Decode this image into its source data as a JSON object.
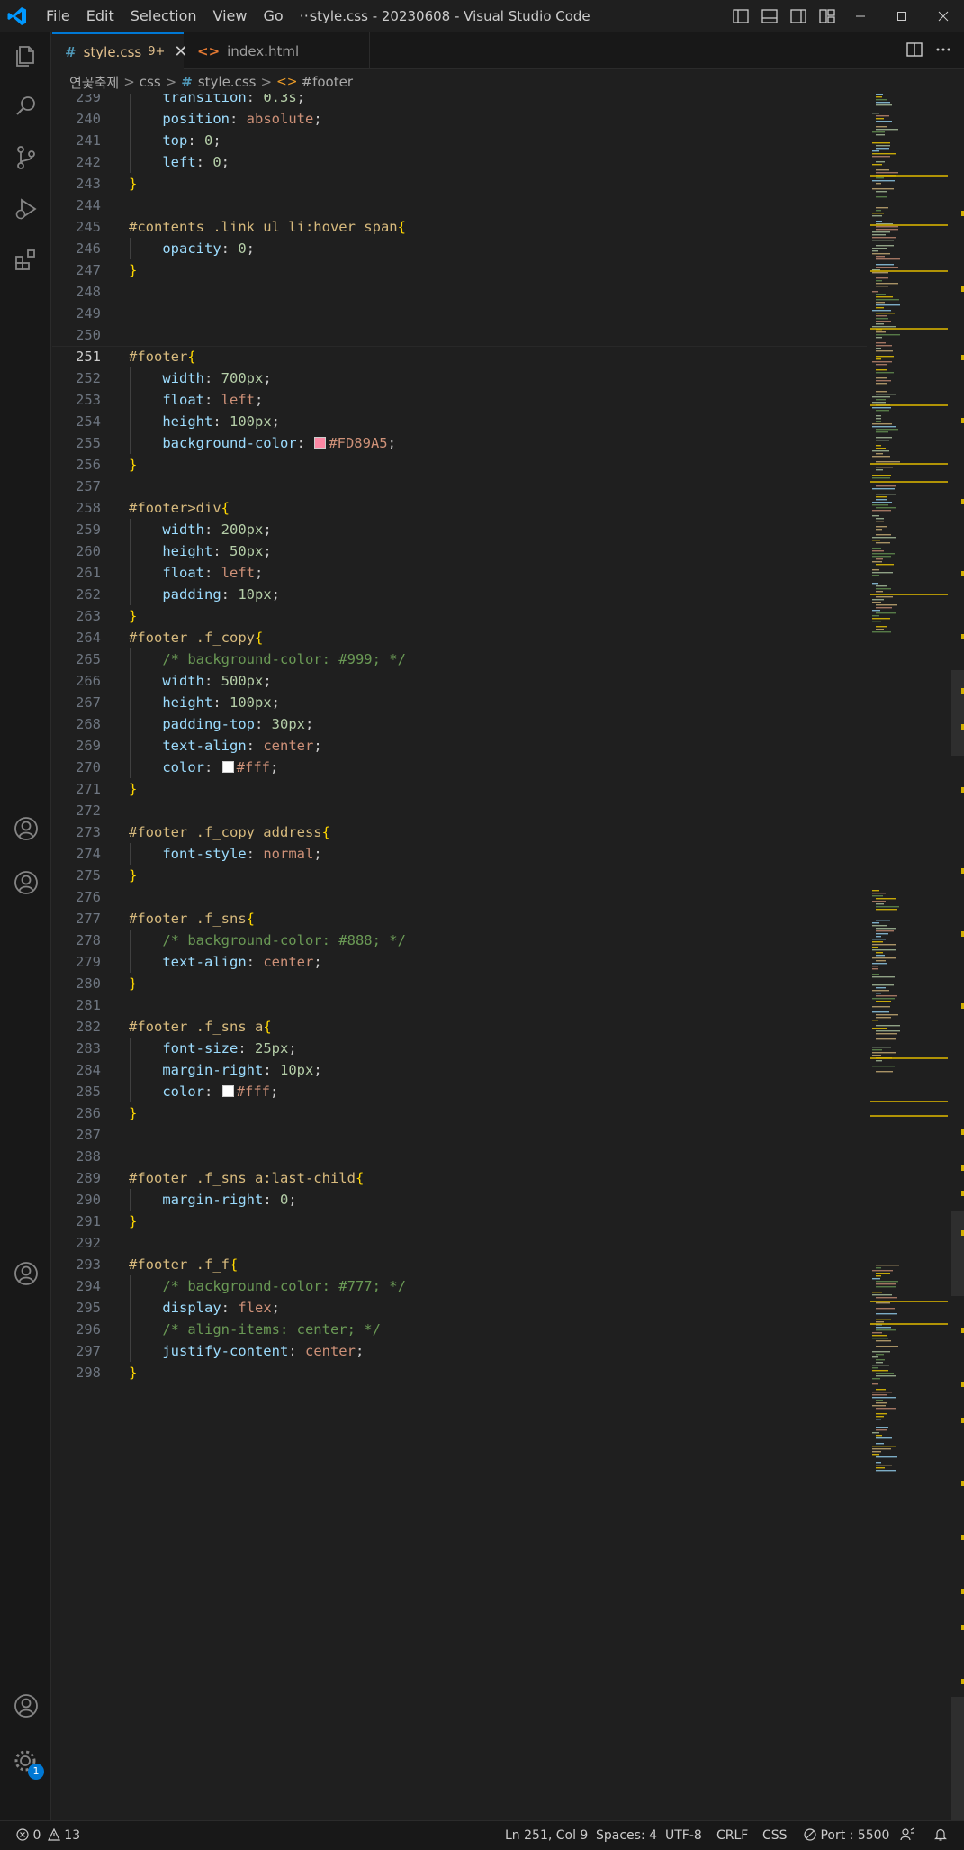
{
  "window": {
    "title": "style.css - 20230608 - Visual Studio Code"
  },
  "menu": [
    "File",
    "Edit",
    "Selection",
    "View",
    "Go",
    "···"
  ],
  "tabs": [
    {
      "label": "style.css",
      "icon": "#",
      "badge": "9+",
      "close": "✕"
    },
    {
      "label": "index.html",
      "icon": "<>"
    }
  ],
  "breadcrumb": {
    "folder": "연꽃축제",
    "subfolder": "css",
    "file": "style.css",
    "file_icon": "#",
    "symbol": "#footer",
    "separator": ">"
  },
  "editor": {
    "cursor_line": "251",
    "lines": [
      {
        "n": "239",
        "t": [
          [
            "pun",
            "    "
          ],
          [
            "prop",
            "transition"
          ],
          [
            "pun",
            ": "
          ],
          [
            "num",
            "0.3s"
          ],
          [
            "pun",
            ";"
          ]
        ]
      },
      {
        "n": "240",
        "t": [
          [
            "pun",
            "    "
          ],
          [
            "prop",
            "position"
          ],
          [
            "pun",
            ": "
          ],
          [
            "kw",
            "absolute"
          ],
          [
            "pun",
            ";"
          ]
        ]
      },
      {
        "n": "241",
        "t": [
          [
            "pun",
            "    "
          ],
          [
            "prop",
            "top"
          ],
          [
            "pun",
            ": "
          ],
          [
            "num",
            "0"
          ],
          [
            "pun",
            ";"
          ]
        ]
      },
      {
        "n": "242",
        "t": [
          [
            "pun",
            "    "
          ],
          [
            "prop",
            "left"
          ],
          [
            "pun",
            ": "
          ],
          [
            "num",
            "0"
          ],
          [
            "pun",
            ";"
          ]
        ]
      },
      {
        "n": "243",
        "t": [
          [
            "br",
            "}"
          ]
        ]
      },
      {
        "n": "244",
        "t": []
      },
      {
        "n": "245",
        "t": [
          [
            "sel",
            "#contents .link ul li:hover span"
          ],
          [
            "br",
            "{"
          ]
        ]
      },
      {
        "n": "246",
        "t": [
          [
            "pun",
            "    "
          ],
          [
            "prop",
            "opacity"
          ],
          [
            "pun",
            ": "
          ],
          [
            "num",
            "0"
          ],
          [
            "pun",
            ";"
          ]
        ]
      },
      {
        "n": "247",
        "t": [
          [
            "br",
            "}"
          ]
        ]
      },
      {
        "n": "248",
        "t": []
      },
      {
        "n": "249",
        "t": []
      },
      {
        "n": "250",
        "t": []
      },
      {
        "n": "251",
        "t": [
          [
            "sel",
            "#footer"
          ],
          [
            "br",
            "{"
          ]
        ]
      },
      {
        "n": "252",
        "t": [
          [
            "pun",
            "    "
          ],
          [
            "prop",
            "width"
          ],
          [
            "pun",
            ": "
          ],
          [
            "num",
            "700px"
          ],
          [
            "pun",
            ";"
          ]
        ]
      },
      {
        "n": "253",
        "t": [
          [
            "pun",
            "    "
          ],
          [
            "prop",
            "float"
          ],
          [
            "pun",
            ": "
          ],
          [
            "kw",
            "left"
          ],
          [
            "pun",
            ";"
          ]
        ]
      },
      {
        "n": "254",
        "t": [
          [
            "pun",
            "    "
          ],
          [
            "prop",
            "height"
          ],
          [
            "pun",
            ": "
          ],
          [
            "num",
            "100px"
          ],
          [
            "pun",
            ";"
          ]
        ]
      },
      {
        "n": "255",
        "t": [
          [
            "pun",
            "    "
          ],
          [
            "prop",
            "background-color"
          ],
          [
            "pun",
            ": "
          ],
          [
            "swatch",
            "#FD89A5"
          ],
          [
            "kw",
            "#FD89A5"
          ],
          [
            "pun",
            ";"
          ]
        ]
      },
      {
        "n": "256",
        "t": [
          [
            "br",
            "}"
          ]
        ]
      },
      {
        "n": "257",
        "t": []
      },
      {
        "n": "258",
        "t": [
          [
            "sel",
            "#footer>div"
          ],
          [
            "br",
            "{"
          ]
        ]
      },
      {
        "n": "259",
        "t": [
          [
            "pun",
            "    "
          ],
          [
            "prop",
            "width"
          ],
          [
            "pun",
            ": "
          ],
          [
            "num",
            "200px"
          ],
          [
            "pun",
            ";"
          ]
        ]
      },
      {
        "n": "260",
        "t": [
          [
            "pun",
            "    "
          ],
          [
            "prop",
            "height"
          ],
          [
            "pun",
            ": "
          ],
          [
            "num",
            "50px"
          ],
          [
            "pun",
            ";"
          ]
        ]
      },
      {
        "n": "261",
        "t": [
          [
            "pun",
            "    "
          ],
          [
            "prop",
            "float"
          ],
          [
            "pun",
            ": "
          ],
          [
            "kw",
            "left"
          ],
          [
            "pun",
            ";"
          ]
        ]
      },
      {
        "n": "262",
        "t": [
          [
            "pun",
            "    "
          ],
          [
            "prop",
            "padding"
          ],
          [
            "pun",
            ": "
          ],
          [
            "num",
            "10px"
          ],
          [
            "pun",
            ";"
          ]
        ]
      },
      {
        "n": "263",
        "t": [
          [
            "br",
            "}"
          ]
        ]
      },
      {
        "n": "264",
        "t": [
          [
            "sel",
            "#footer .f_copy"
          ],
          [
            "br",
            "{"
          ]
        ]
      },
      {
        "n": "265",
        "t": [
          [
            "pun",
            "    "
          ],
          [
            "cmt",
            "/* background-color: #999; */"
          ]
        ]
      },
      {
        "n": "266",
        "t": [
          [
            "pun",
            "    "
          ],
          [
            "prop",
            "width"
          ],
          [
            "pun",
            ": "
          ],
          [
            "num",
            "500px"
          ],
          [
            "pun",
            ";"
          ]
        ]
      },
      {
        "n": "267",
        "t": [
          [
            "pun",
            "    "
          ],
          [
            "prop",
            "height"
          ],
          [
            "pun",
            ": "
          ],
          [
            "num",
            "100px"
          ],
          [
            "pun",
            ";"
          ]
        ]
      },
      {
        "n": "268",
        "t": [
          [
            "pun",
            "    "
          ],
          [
            "prop",
            "padding-top"
          ],
          [
            "pun",
            ": "
          ],
          [
            "num",
            "30px"
          ],
          [
            "pun",
            ";"
          ]
        ]
      },
      {
        "n": "269",
        "t": [
          [
            "pun",
            "    "
          ],
          [
            "prop",
            "text-align"
          ],
          [
            "pun",
            ": "
          ],
          [
            "kw",
            "center"
          ],
          [
            "pun",
            ";"
          ]
        ]
      },
      {
        "n": "270",
        "t": [
          [
            "pun",
            "    "
          ],
          [
            "prop",
            "color"
          ],
          [
            "pun",
            ": "
          ],
          [
            "swatch",
            "#ffffff"
          ],
          [
            "kw",
            "#fff"
          ],
          [
            "pun",
            ";"
          ]
        ]
      },
      {
        "n": "271",
        "t": [
          [
            "br",
            "}"
          ]
        ]
      },
      {
        "n": "272",
        "t": []
      },
      {
        "n": "273",
        "t": [
          [
            "sel",
            "#footer .f_copy address"
          ],
          [
            "br",
            "{"
          ]
        ]
      },
      {
        "n": "274",
        "t": [
          [
            "pun",
            "    "
          ],
          [
            "prop",
            "font-style"
          ],
          [
            "pun",
            ": "
          ],
          [
            "kw",
            "normal"
          ],
          [
            "pun",
            ";"
          ]
        ]
      },
      {
        "n": "275",
        "t": [
          [
            "br",
            "}"
          ]
        ]
      },
      {
        "n": "276",
        "t": []
      },
      {
        "n": "277",
        "t": [
          [
            "sel",
            "#footer .f_sns"
          ],
          [
            "br",
            "{"
          ]
        ]
      },
      {
        "n": "278",
        "t": [
          [
            "pun",
            "    "
          ],
          [
            "cmt",
            "/* background-color: #888; */"
          ]
        ]
      },
      {
        "n": "279",
        "t": [
          [
            "pun",
            "    "
          ],
          [
            "prop",
            "text-align"
          ],
          [
            "pun",
            ": "
          ],
          [
            "kw",
            "center"
          ],
          [
            "pun",
            ";"
          ]
        ]
      },
      {
        "n": "280",
        "t": [
          [
            "br",
            "}"
          ]
        ]
      },
      {
        "n": "281",
        "t": []
      },
      {
        "n": "282",
        "t": [
          [
            "sel",
            "#footer .f_sns a"
          ],
          [
            "br",
            "{"
          ]
        ]
      },
      {
        "n": "283",
        "t": [
          [
            "pun",
            "    "
          ],
          [
            "prop",
            "font-size"
          ],
          [
            "pun",
            ": "
          ],
          [
            "num",
            "25px"
          ],
          [
            "pun",
            ";"
          ]
        ]
      },
      {
        "n": "284",
        "t": [
          [
            "pun",
            "    "
          ],
          [
            "prop",
            "margin-right"
          ],
          [
            "pun",
            ": "
          ],
          [
            "num",
            "10px"
          ],
          [
            "pun",
            ";"
          ]
        ]
      },
      {
        "n": "285",
        "t": [
          [
            "pun",
            "    "
          ],
          [
            "prop",
            "color"
          ],
          [
            "pun",
            ": "
          ],
          [
            "swatch",
            "#ffffff"
          ],
          [
            "kw",
            "#fff"
          ],
          [
            "pun",
            ";"
          ]
        ]
      },
      {
        "n": "286",
        "t": [
          [
            "br",
            "}"
          ]
        ]
      },
      {
        "n": "287",
        "t": []
      },
      {
        "n": "288",
        "t": []
      },
      {
        "n": "289",
        "t": [
          [
            "sel",
            "#footer .f_sns a:last-child"
          ],
          [
            "br",
            "{"
          ]
        ]
      },
      {
        "n": "290",
        "t": [
          [
            "pun",
            "    "
          ],
          [
            "prop",
            "margin-right"
          ],
          [
            "pun",
            ": "
          ],
          [
            "num",
            "0"
          ],
          [
            "pun",
            ";"
          ]
        ]
      },
      {
        "n": "291",
        "t": [
          [
            "br",
            "}"
          ]
        ]
      },
      {
        "n": "292",
        "t": []
      },
      {
        "n": "293",
        "t": [
          [
            "sel",
            "#footer .f_f"
          ],
          [
            "br",
            "{"
          ]
        ]
      },
      {
        "n": "294",
        "t": [
          [
            "pun",
            "    "
          ],
          [
            "cmt",
            "/* background-color: #777; */"
          ]
        ]
      },
      {
        "n": "295",
        "t": [
          [
            "pun",
            "    "
          ],
          [
            "prop",
            "display"
          ],
          [
            "pun",
            ": "
          ],
          [
            "kw",
            "flex"
          ],
          [
            "pun",
            ";"
          ]
        ]
      },
      {
        "n": "296",
        "t": [
          [
            "pun",
            "    "
          ],
          [
            "cmt",
            "/* align-items: center; */"
          ]
        ]
      },
      {
        "n": "297",
        "t": [
          [
            "pun",
            "    "
          ],
          [
            "prop",
            "justify-content"
          ],
          [
            "pun",
            ": "
          ],
          [
            "kw",
            "center"
          ],
          [
            "pun",
            ";"
          ]
        ]
      },
      {
        "n": "298",
        "t": [
          [
            "br",
            "}"
          ]
        ]
      }
    ]
  },
  "activity": {
    "settings_badge": "1"
  },
  "status": {
    "errors": "0",
    "warnings": "13",
    "position": "Ln 251, Col 9",
    "indent": "Spaces: 4",
    "encoding": "UTF-8",
    "eol": "CRLF",
    "language": "CSS",
    "port": "Port : 5500"
  },
  "colors": {
    "accent": "#0078d4",
    "selector": "#d7ba7d",
    "bracket": "#ffd700",
    "property": "#9cdcfe",
    "number": "#b5cea8",
    "keyword": "#ce9178",
    "comment": "#6a9955",
    "scroll_marker": "#d4b000"
  }
}
